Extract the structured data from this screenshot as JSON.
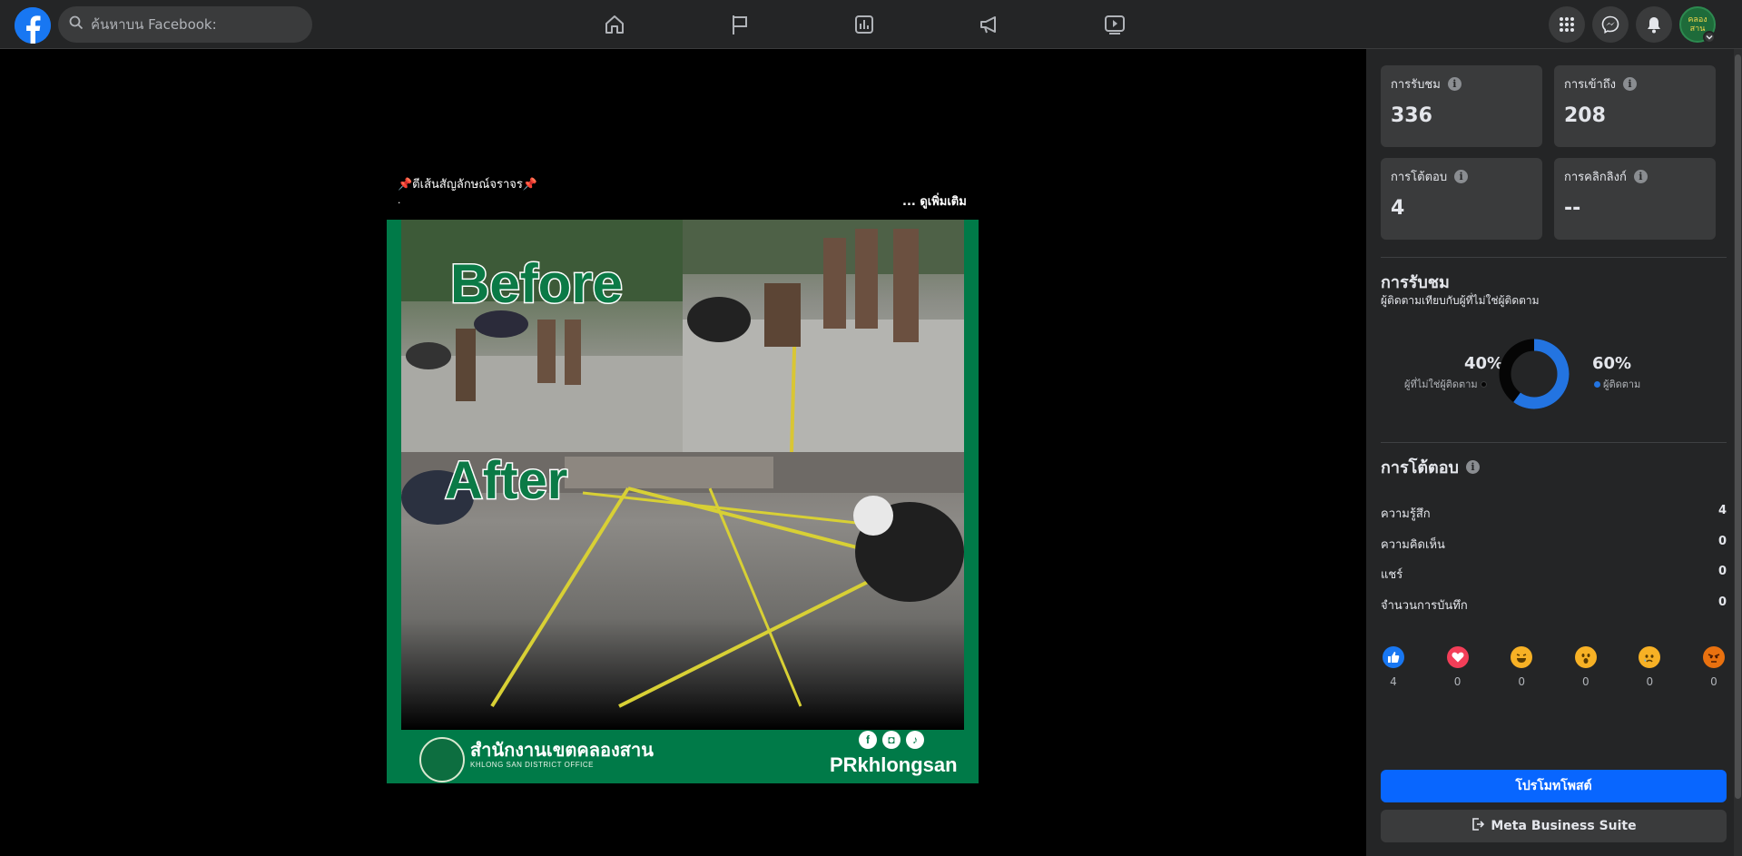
{
  "header": {
    "search_placeholder": "ค้นหาบน Facebook:",
    "nav_icons": [
      "home-icon",
      "flag-icon",
      "chart-icon",
      "megaphone-icon",
      "video-icon"
    ],
    "right_icons": [
      "menu-grid-icon",
      "messenger-icon",
      "bell-icon"
    ],
    "avatar_text": "คลอง\nสาน"
  },
  "post": {
    "caption": "📌ตีเส้นสัญลักษณ์จราจร📌",
    "caption_line2": ".",
    "see_more": "... ดูเพิ่มเติม",
    "image": {
      "before_text": "Before",
      "after_text": "After",
      "office_th": "สำนักงานเขตคลองสาน",
      "office_en": "KHLONG SAN DISTRICT OFFICE",
      "handle": "PRkhlongsan",
      "social": [
        "f",
        "◘",
        "♪"
      ]
    }
  },
  "panel": {
    "stats": [
      {
        "label": "การรับชม",
        "value": "336"
      },
      {
        "label": "การเข้าถึง",
        "value": "208"
      },
      {
        "label": "การโต้ตอบ",
        "value": "4"
      },
      {
        "label": "การคลิกลิงก์",
        "value": "--"
      }
    ],
    "views": {
      "title": "การรับชม",
      "subtitle": "ผู้ติดตามเทียบกับผู้ที่ไม่ใช่ผู้ติดตาม",
      "non_followers_pct": "40%",
      "non_followers_label": "ผู้ที่ไม่ใช่ผู้ติดตาม",
      "followers_pct": "60%",
      "followers_label": "ผู้ติดตาม",
      "followers_fraction": 0.6,
      "colors": {
        "followers": "#2374e1",
        "non_followers": "#050505"
      }
    },
    "interactions": {
      "title": "การโต้ตอบ",
      "rows": [
        {
          "label": "ความรู้สึก",
          "value": "4"
        },
        {
          "label": "ความคิดเห็น",
          "value": "0"
        },
        {
          "label": "แชร์",
          "value": "0"
        },
        {
          "label": "จำนวนการบันทึก",
          "value": "0"
        }
      ],
      "reactions": [
        {
          "icon": "like-icon",
          "count": "4",
          "color": "#1877f2",
          "glyph": "👍"
        },
        {
          "icon": "love-icon",
          "count": "0",
          "color": "#f33e58",
          "glyph": "♥"
        },
        {
          "icon": "haha-icon",
          "count": "0",
          "color": "#f7b125",
          "glyph": "😆"
        },
        {
          "icon": "wow-icon",
          "count": "0",
          "color": "#f7b125",
          "glyph": "😮"
        },
        {
          "icon": "sad-icon",
          "count": "0",
          "color": "#f7b125",
          "glyph": "😢"
        },
        {
          "icon": "angry-icon",
          "count": "0",
          "color": "#e9710f",
          "glyph": "😡"
        }
      ]
    },
    "buttons": {
      "promote": "โปรโมทโพสต์",
      "business_suite": "Meta Business Suite"
    }
  }
}
